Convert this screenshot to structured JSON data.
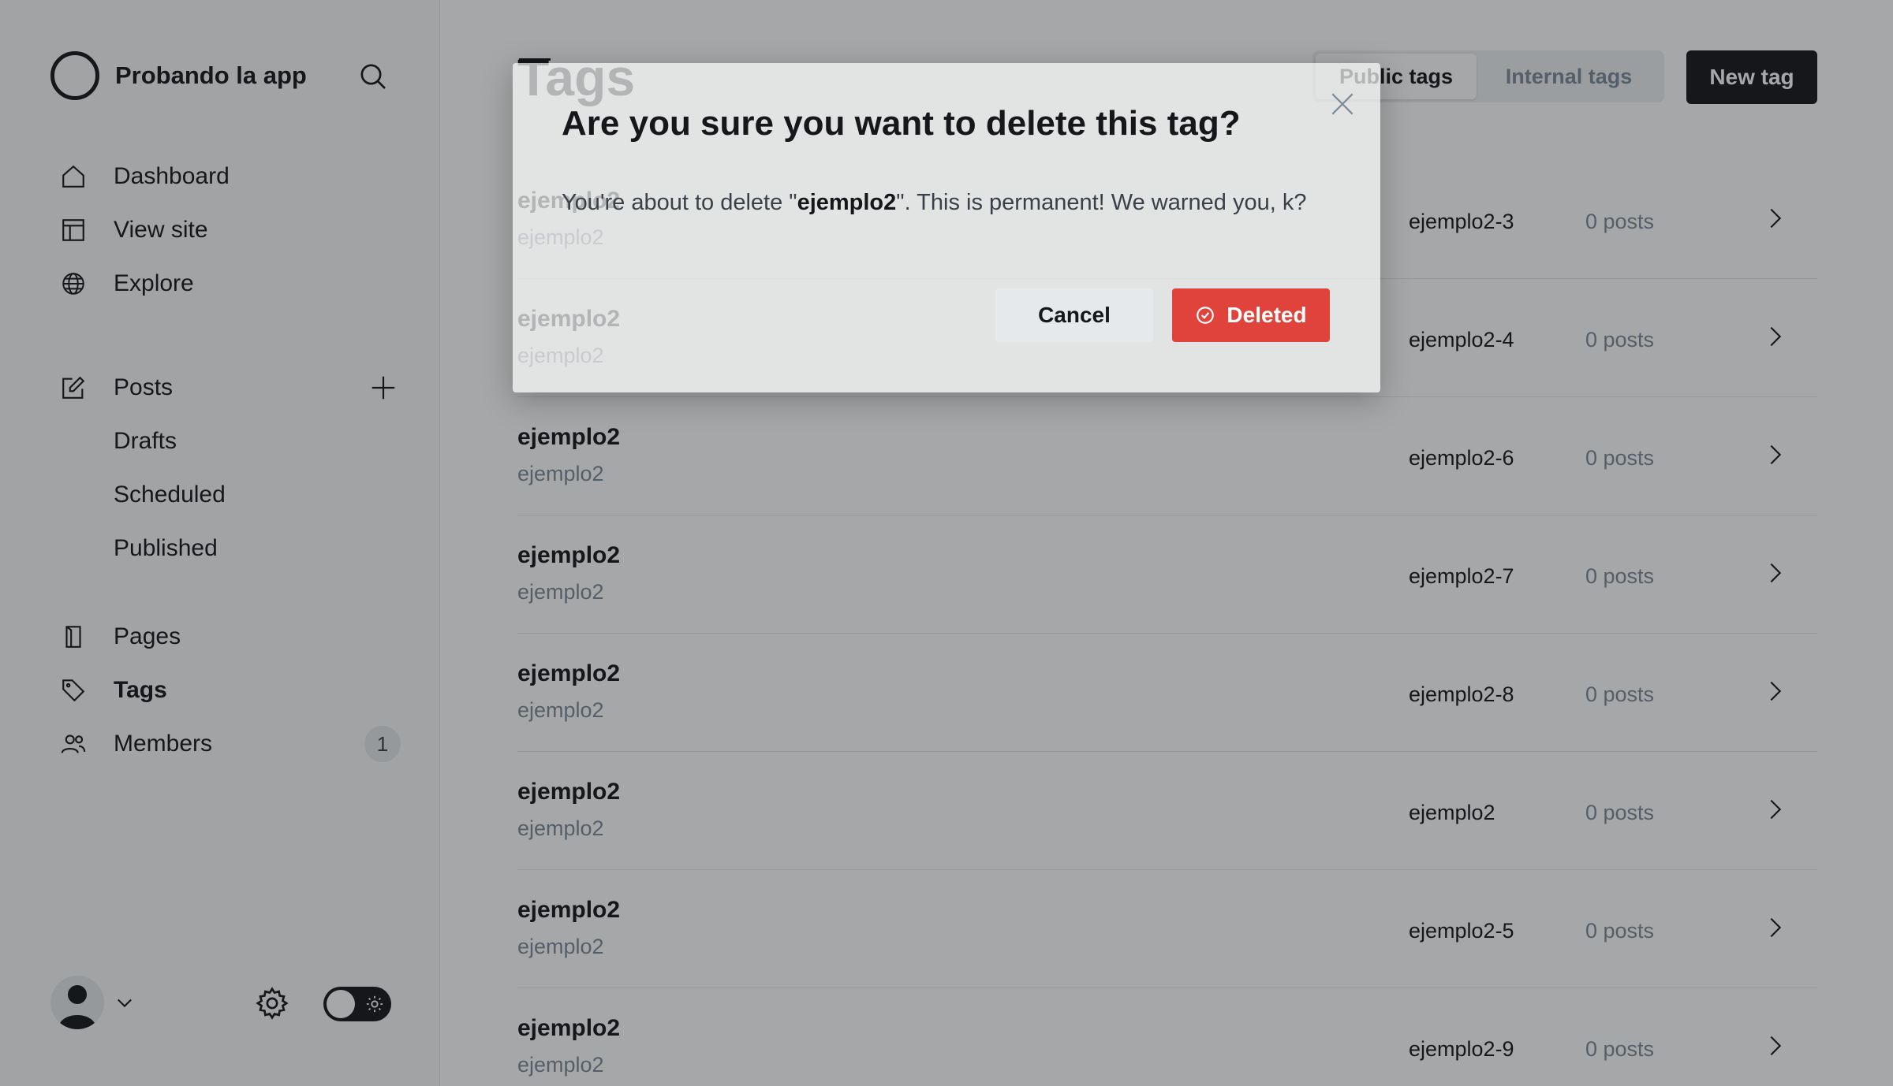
{
  "sidebar": {
    "brand": {
      "title": "Probando la app",
      "logo_icon": "ghost-logo-icon"
    },
    "search_icon": "search-icon",
    "primary_nav": [
      {
        "label": "Dashboard",
        "icon": "home-icon"
      },
      {
        "label": "View site",
        "icon": "layout-icon"
      },
      {
        "label": "Explore",
        "icon": "globe-icon"
      }
    ],
    "posts": {
      "label": "Posts",
      "icon": "edit-icon",
      "add_icon": "plus-icon",
      "sub_items": [
        "Drafts",
        "Scheduled",
        "Published"
      ]
    },
    "secondary_nav": [
      {
        "label": "Pages",
        "icon": "book-icon"
      },
      {
        "label": "Tags",
        "icon": "tag-icon",
        "active": true
      },
      {
        "label": "Members",
        "icon": "members-icon",
        "badge": "1"
      }
    ],
    "footer": {
      "avatar_icon": "user-avatar-icon",
      "chevron_icon": "chevron-down-icon",
      "settings_icon": "gear-icon",
      "theme_toggle_icon": "sun-icon"
    }
  },
  "main": {
    "title": "Tags",
    "tabs": [
      {
        "label": "Public tags",
        "active": true
      },
      {
        "label": "Internal tags",
        "active": false
      }
    ],
    "new_tag_label": "New tag",
    "tags": [
      {
        "name": "ejemplo2",
        "description": "ejemplo2",
        "slug": "ejemplo2-3",
        "count": "0 posts"
      },
      {
        "name": "ejemplo2",
        "description": "ejemplo2",
        "slug": "ejemplo2-4",
        "count": "0 posts"
      },
      {
        "name": "ejemplo2",
        "description": "ejemplo2",
        "slug": "ejemplo2-6",
        "count": "0 posts"
      },
      {
        "name": "ejemplo2",
        "description": "ejemplo2",
        "slug": "ejemplo2-7",
        "count": "0 posts"
      },
      {
        "name": "ejemplo2",
        "description": "ejemplo2",
        "slug": "ejemplo2-8",
        "count": "0 posts"
      },
      {
        "name": "ejemplo2",
        "description": "ejemplo2",
        "slug": "ejemplo2",
        "count": "0 posts"
      },
      {
        "name": "ejemplo2",
        "description": "ejemplo2",
        "slug": "ejemplo2-5",
        "count": "0 posts"
      },
      {
        "name": "ejemplo2",
        "description": "ejemplo2",
        "slug": "ejemplo2-9",
        "count": "0 posts"
      }
    ]
  },
  "modal": {
    "title": "Are you sure you want to delete this tag?",
    "body_prefix": "You're about to delete \"",
    "body_tag": "ejemplo2",
    "body_suffix": "\". This is permanent! We warned you, k?",
    "cancel_label": "Cancel",
    "delete_label": "Deleted",
    "close_icon": "close-icon",
    "delete_icon": "check-circle-icon"
  },
  "colors": {
    "accent_dark": "#15171a",
    "danger": "#e0433b",
    "muted": "#7c8b9a"
  }
}
